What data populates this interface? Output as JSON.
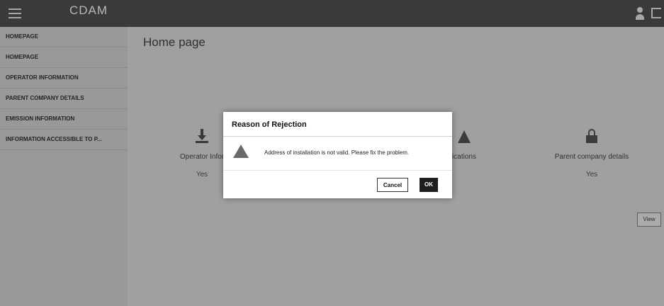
{
  "header": {
    "brand_name": "CDAM",
    "brand_subtitle": "",
    "user_name": ""
  },
  "sidebar": {
    "items": [
      {
        "label": "HOMEPAGE"
      },
      {
        "label": "HOMEPAGE"
      },
      {
        "label": "OPERATOR INFORMATION"
      },
      {
        "label": "PARENT COMPANY DETAILS"
      },
      {
        "label": "EMISSION INFORMATION"
      },
      {
        "label": "INFORMATION ACCESSIBLE TO P..."
      }
    ]
  },
  "main": {
    "page_title": "Home page",
    "intro_line_1": "",
    "intro_line_2": "",
    "cards": [
      {
        "label": "Operator Infor",
        "status": "Yes"
      },
      {
        "label": "ications",
        "status": ""
      },
      {
        "label": "Parent company details",
        "status": "Yes"
      }
    ],
    "rejected_message": "",
    "created_text": "",
    "view_button_label": "View"
  },
  "footer": {
    "text": ""
  },
  "modal": {
    "title": "Reason of Rejection",
    "message": "Address of installation is not valid. Please fix the problem.",
    "cancel_label": "Cancel",
    "ok_label": "OK"
  }
}
